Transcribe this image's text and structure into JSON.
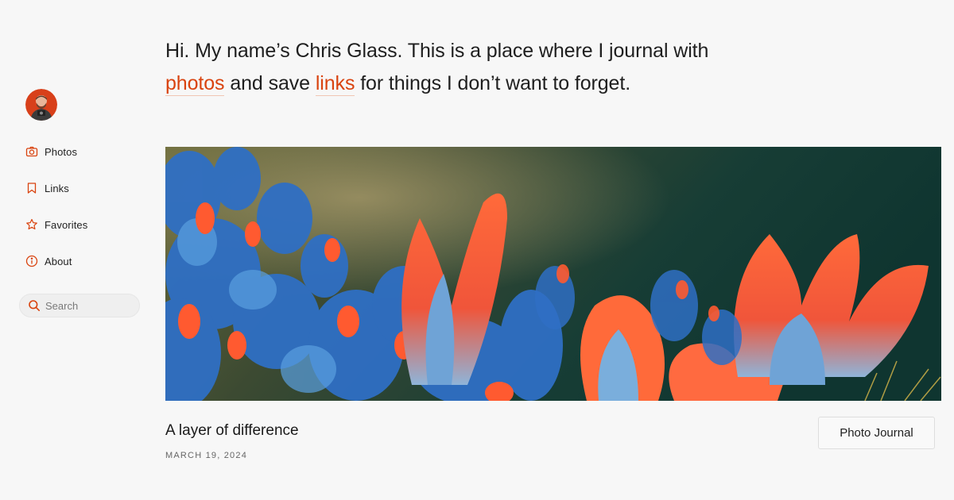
{
  "sidebar": {
    "avatar_alt": "Chris Glass",
    "items": [
      {
        "label": "Photos",
        "icon": "camera-icon"
      },
      {
        "label": "Links",
        "icon": "bookmark-icon"
      },
      {
        "label": "Favorites",
        "icon": "star-icon"
      },
      {
        "label": "About",
        "icon": "info-icon"
      }
    ],
    "search": {
      "placeholder": "Search",
      "value": ""
    }
  },
  "intro": {
    "part1": "Hi. My name’s Chris Glass. This is a place where I journal with ",
    "link1": "photos",
    "part2": " and save ",
    "link2": "links",
    "part3": " for things I don’t want to forget."
  },
  "post": {
    "title": "A layer of difference",
    "date": "MARCH 19, 2024",
    "category": "Photo Journal"
  },
  "colors": {
    "accent": "#d9430f",
    "background": "#f7f7f7",
    "text": "#1f1f1f"
  }
}
